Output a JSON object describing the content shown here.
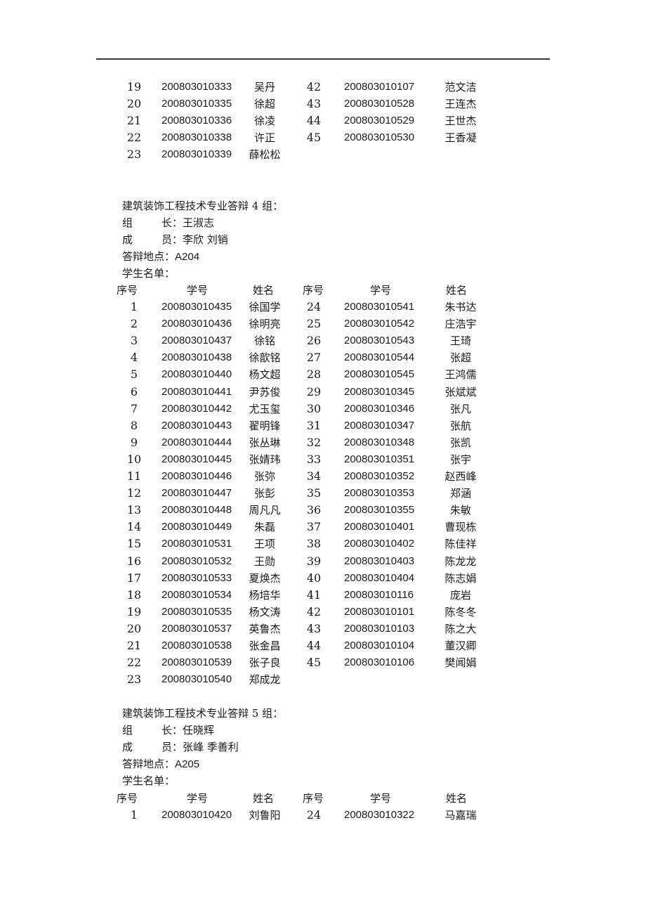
{
  "headers": {
    "seq": "序号",
    "sid": "学号",
    "name": "姓名"
  },
  "labels": {
    "leader_a": "组",
    "leader_b": "长：",
    "members_a": "成",
    "members_b": "员：",
    "location": "答辩地点：",
    "roster": "学生名单："
  },
  "continued": {
    "rows": [
      {
        "l_no": "19",
        "l_id": "200803010333",
        "l_name": "吴丹",
        "r_no": "42",
        "r_id": "200803010107",
        "r_name": "范文洁"
      },
      {
        "l_no": "20",
        "l_id": "200803010335",
        "l_name": "徐超",
        "r_no": "43",
        "r_id": "200803010528",
        "r_name": "王连杰"
      },
      {
        "l_no": "21",
        "l_id": "200803010336",
        "l_name": "徐凌",
        "r_no": "44",
        "r_id": "200803010529",
        "r_name": "王世杰"
      },
      {
        "l_no": "22",
        "l_id": "200803010338",
        "l_name": "许正",
        "r_no": "45",
        "r_id": "200803010530",
        "r_name": "王香凝"
      },
      {
        "l_no": "23",
        "l_id": "200803010339",
        "l_name": "薛松松",
        "r_no": "",
        "r_id": "",
        "r_name": ""
      }
    ]
  },
  "group4": {
    "title": "建筑装饰工程技术专业答辩 4 组：",
    "leader": "王淑志",
    "members": "李欣 刘销",
    "location": "A204",
    "rows": [
      {
        "l_no": "1",
        "l_id": "200803010435",
        "l_name": "徐国学",
        "r_no": "24",
        "r_id": "200803010541",
        "r_name": "朱书达"
      },
      {
        "l_no": "2",
        "l_id": "200803010436",
        "l_name": "徐明亮",
        "r_no": "25",
        "r_id": "200803010542",
        "r_name": "庄浩宇"
      },
      {
        "l_no": "3",
        "l_id": "200803010437",
        "l_name": "徐铭",
        "r_no": "26",
        "r_id": "200803010543",
        "r_name": "王琦"
      },
      {
        "l_no": "4",
        "l_id": "200803010438",
        "l_name": "徐歆铭",
        "r_no": "27",
        "r_id": "200803010544",
        "r_name": "张超"
      },
      {
        "l_no": "5",
        "l_id": "200803010440",
        "l_name": "杨文超",
        "r_no": "28",
        "r_id": "200803010545",
        "r_name": "王鸿儒"
      },
      {
        "l_no": "6",
        "l_id": "200803010441",
        "l_name": "尹苏俊",
        "r_no": "29",
        "r_id": "200803010345",
        "r_name": "张斌斌"
      },
      {
        "l_no": "7",
        "l_id": "200803010442",
        "l_name": "尤玉玺",
        "r_no": "30",
        "r_id": "200803010346",
        "r_name": "张凡"
      },
      {
        "l_no": "8",
        "l_id": "200803010443",
        "l_name": "翟明锋",
        "r_no": "31",
        "r_id": "200803010347",
        "r_name": "张航"
      },
      {
        "l_no": "9",
        "l_id": "200803010444",
        "l_name": "张丛琳",
        "r_no": "32",
        "r_id": "200803010348",
        "r_name": "张凯"
      },
      {
        "l_no": "10",
        "l_id": "200803010445",
        "l_name": "张婧玮",
        "r_no": "33",
        "r_id": "200803010351",
        "r_name": "张宇"
      },
      {
        "l_no": "11",
        "l_id": "200803010446",
        "l_name": "张弥",
        "r_no": "34",
        "r_id": "200803010352",
        "r_name": "赵西峰"
      },
      {
        "l_no": "12",
        "l_id": "200803010447",
        "l_name": "张彭",
        "r_no": "35",
        "r_id": "200803010353",
        "r_name": "郑涵"
      },
      {
        "l_no": "13",
        "l_id": "200803010448",
        "l_name": "周凡凡",
        "r_no": "36",
        "r_id": "200803010355",
        "r_name": "朱敏"
      },
      {
        "l_no": "14",
        "l_id": "200803010449",
        "l_name": "朱磊",
        "r_no": "37",
        "r_id": "200803010401",
        "r_name": "曹现栋"
      },
      {
        "l_no": "15",
        "l_id": "200803010531",
        "l_name": "王项",
        "r_no": "38",
        "r_id": "200803010402",
        "r_name": "陈佳祥"
      },
      {
        "l_no": "16",
        "l_id": "200803010532",
        "l_name": "王勋",
        "r_no": "39",
        "r_id": "200803010403",
        "r_name": "陈龙龙"
      },
      {
        "l_no": "17",
        "l_id": "200803010533",
        "l_name": "夏焕杰",
        "r_no": "40",
        "r_id": "200803010404",
        "r_name": "陈志娟"
      },
      {
        "l_no": "18",
        "l_id": "200803010534",
        "l_name": "杨培华",
        "r_no": "41",
        "r_id": "200803010116",
        "r_name": "庞岩"
      },
      {
        "l_no": "19",
        "l_id": "200803010535",
        "l_name": "杨文涛",
        "r_no": "42",
        "r_id": "200803010101",
        "r_name": "陈冬冬"
      },
      {
        "l_no": "20",
        "l_id": "200803010537",
        "l_name": "英鲁杰",
        "r_no": "43",
        "r_id": "200803010103",
        "r_name": "陈之大"
      },
      {
        "l_no": "21",
        "l_id": "200803010538",
        "l_name": "张金昌",
        "r_no": "44",
        "r_id": "200803010104",
        "r_name": "董汉卿"
      },
      {
        "l_no": "22",
        "l_id": "200803010539",
        "l_name": "张子良",
        "r_no": "45",
        "r_id": "200803010106",
        "r_name": "樊闻娟"
      },
      {
        "l_no": "23",
        "l_id": "200803010540",
        "l_name": "郑成龙",
        "r_no": "",
        "r_id": "",
        "r_name": ""
      }
    ]
  },
  "group5": {
    "title": "建筑装饰工程技术专业答辩 5 组：",
    "leader": "任晓辉",
    "members": "张峰 季善利",
    "location": "A205",
    "rows": [
      {
        "l_no": "1",
        "l_id": "200803010420",
        "l_name": "刘鲁阳",
        "r_no": "24",
        "r_id": "200803010322",
        "r_name": "马嘉瑞"
      }
    ]
  }
}
